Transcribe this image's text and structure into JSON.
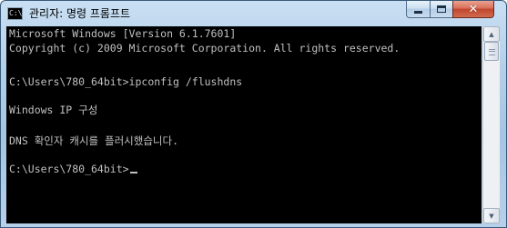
{
  "window": {
    "title": "관리자: 명령 프롬프트",
    "app_icon": "cmd-icon",
    "app_icon_text": "C:\\",
    "controls": {
      "minimize_icon": "minimize-icon",
      "maximize_icon": "maximize-icon",
      "close_icon": "close-icon",
      "close_glyph": "✕"
    }
  },
  "console": {
    "lines": [
      "Microsoft Windows [Version 6.1.7601]",
      "Copyright (c) 2009 Microsoft Corporation. All rights reserved.",
      "",
      "C:\\Users\\780_64bit>ipconfig /flushdns",
      "",
      "Windows IP 구성",
      "",
      "DNS 확인자 캐시를 플러시했습니다.",
      "",
      "C:\\Users\\780_64bit>"
    ],
    "colors": {
      "background": "#000000",
      "text": "#c0c0c0"
    }
  },
  "scrollbar": {
    "up_arrow": "▲",
    "down_arrow": "▼"
  }
}
